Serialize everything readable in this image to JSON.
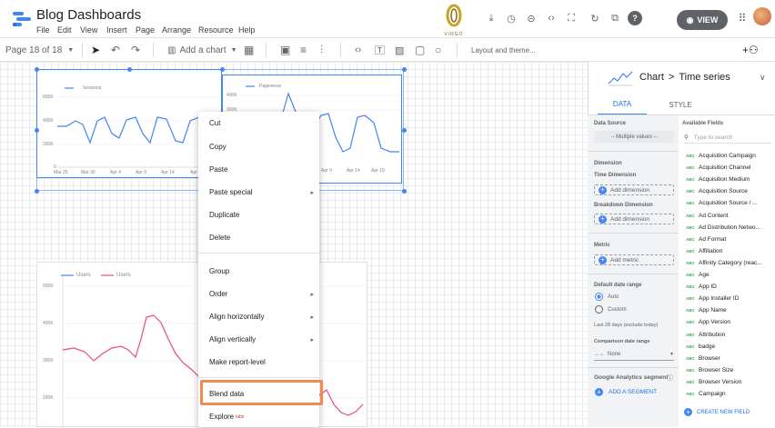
{
  "app": {
    "title": "Blog Dashboards",
    "menu": [
      "File",
      "Edit",
      "View",
      "Insert",
      "Page",
      "Arrange",
      "Resource",
      "Help"
    ],
    "brand": "VIRGO",
    "view_label": "VIEW"
  },
  "toolbar": {
    "page": "Page 18 of 18",
    "add_chart": "Add a chart",
    "layout_theme": "Layout and theme..."
  },
  "chart1": {
    "legend": "Sessions",
    "y_ticks": [
      "600K",
      "400K",
      "200K",
      "0"
    ],
    "x_ticks": [
      "Mar 25",
      "Mar 30",
      "Apr 4",
      "Apr 9",
      "Apr 14",
      "Apr"
    ]
  },
  "chart2": {
    "legend": "Pageviews",
    "y_ticks": [
      "400K",
      "300K"
    ],
    "x_ticks": [
      "Apr 9",
      "Apr 14",
      "Apr 19"
    ]
  },
  "chart3": {
    "legend": [
      "Users",
      "Users"
    ],
    "y_ticks": [
      "500K",
      "400K",
      "300K",
      "200K"
    ]
  },
  "context_menu": {
    "items": [
      "Cut",
      "Copy",
      "Paste",
      "Paste special",
      "Duplicate",
      "Delete",
      "Group",
      "Order",
      "Align horizontally",
      "Align vertically",
      "Make report-level",
      "Blend data",
      "Explore"
    ],
    "explore_badge": "labs"
  },
  "panel": {
    "breadcrumb": [
      "Chart",
      ">",
      "Time series"
    ],
    "tabs": [
      "DATA",
      "STYLE"
    ],
    "data_source_label": "Data Source",
    "data_source_value": "-- Multiple values --",
    "dimension_label": "Dimension",
    "time_dimension_label": "Time Dimension",
    "add_dimension": "Add dimension",
    "breakdown_label": "Breakdown Dimension",
    "metric_label": "Metric",
    "add_metric": "Add metric",
    "date_range_label": "Default date range",
    "auto": "Auto",
    "custom": "Custom",
    "last_28": "Last 28 days (exclude today)",
    "comparison_label": "Comparison date range",
    "none": "None",
    "segment_label": "Google Analytics segment",
    "add_segment": "ADD A SEGMENT",
    "fields_label": "Available Fields",
    "search_placeholder": "Type to search",
    "field_type": "ABC",
    "fields": [
      "Acquisition Campaign",
      "Acquisition Channel",
      "Acquisition Medium",
      "Acquisition Source",
      "Acquisition Source / ...",
      "Ad Content",
      "Ad Distribution Netwo...",
      "Ad Format",
      "Affiliation",
      "Affinity Category (reac...",
      "Age",
      "App ID",
      "App Installer ID",
      "App Name",
      "App Version",
      "Attribution",
      "badge",
      "Browser",
      "Browser Size",
      "Browser Version",
      "Campaign"
    ],
    "create_field": "CREATE NEW FIELD"
  },
  "colors": {
    "accent": "#4285f4",
    "highlight": "#f28b50",
    "series_blue": "#4285f4",
    "series_pink": "#e94b7b"
  }
}
